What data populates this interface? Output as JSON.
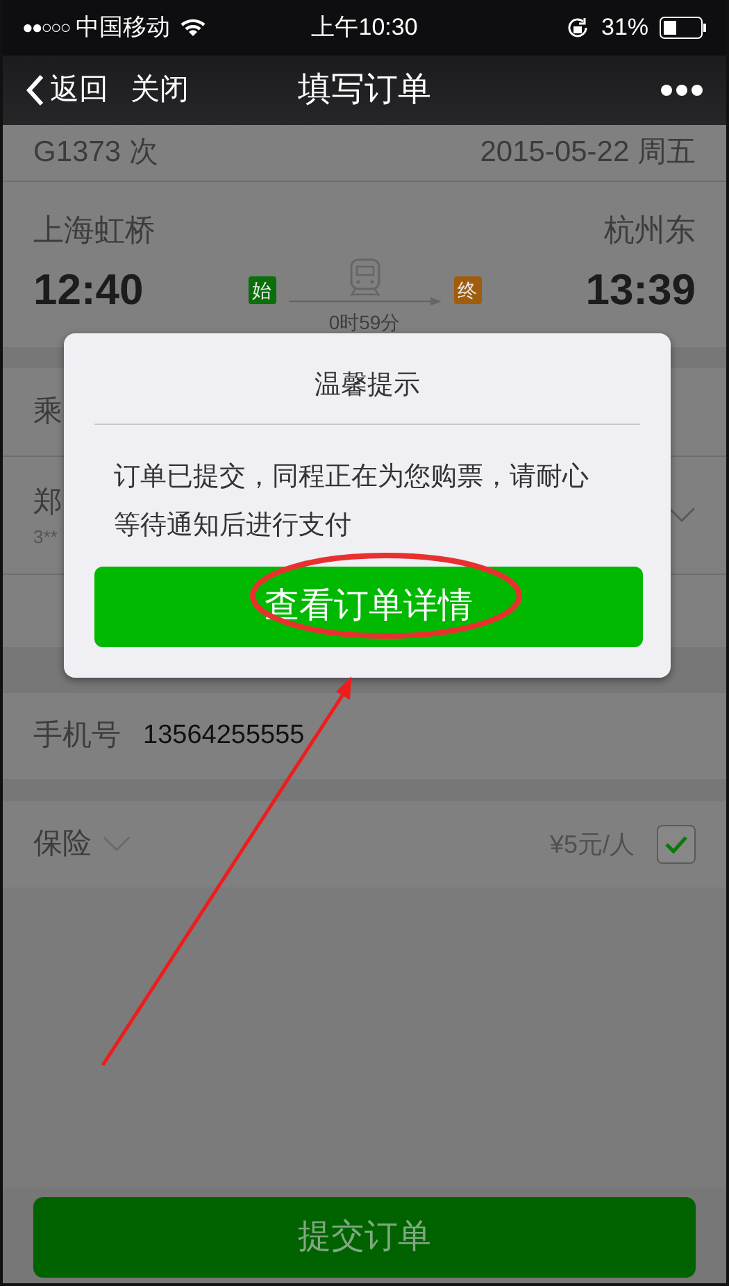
{
  "status_bar": {
    "carrier": "中国移动",
    "signal": "●●○○○",
    "time": "上午10:30",
    "battery": "31%"
  },
  "nav": {
    "back": "返回",
    "close": "关闭",
    "title": "填写订单"
  },
  "train": {
    "number": "G1373 次",
    "date": "2015-05-22 周五",
    "from": "上海虹桥",
    "to": "杭州东",
    "depart": "12:40",
    "arrive": "13:39",
    "start_tag": "始",
    "end_tag": "终",
    "duration": "0时59分"
  },
  "passengers": {
    "label": "乘",
    "name": "郑",
    "id": "3**"
  },
  "phone": {
    "label": "手机号",
    "value": "13564255555"
  },
  "insurance": {
    "label": "保险",
    "price": "¥5元/人",
    "checked": true
  },
  "submit": "提交订单",
  "dialog": {
    "title": "温馨提示",
    "message": "订单已提交，同程正在为您购票，请耐心等待通知后进行支付",
    "button": "查看订单详情"
  }
}
